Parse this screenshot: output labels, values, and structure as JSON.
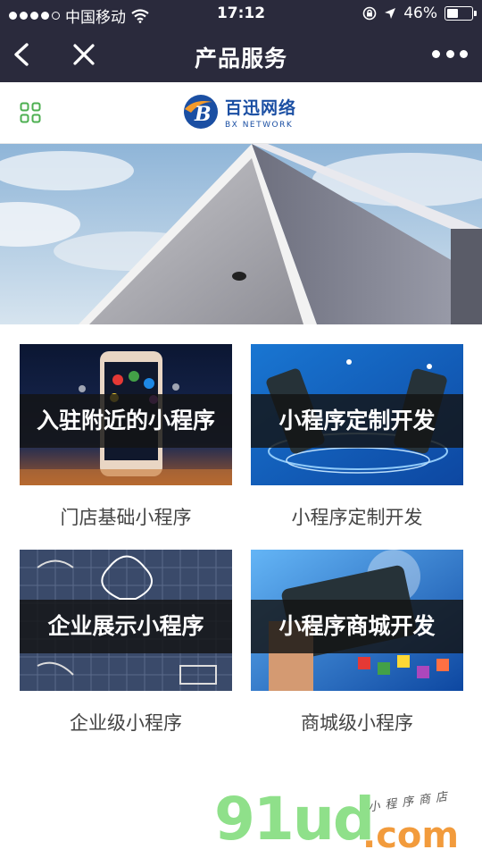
{
  "status_bar": {
    "carrier": "中国移动",
    "time": "17:12",
    "battery": "46%",
    "battery_level": 0.46,
    "signal_bars_filled": 4,
    "signal_bars_total": 5
  },
  "nav": {
    "title": "产品服务",
    "back_icon": "chevron-left-icon",
    "close_icon": "close-icon",
    "more_icon": "more-dots-icon"
  },
  "brand": {
    "name_cn": "百迅网络",
    "name_en": "BX NETWORK",
    "menu_icon": "grid-icon",
    "color": "#1b4fa3",
    "accent": "#f39a2b"
  },
  "products": [
    {
      "overlay": "入驻附近的小程序",
      "caption": "门店基础小程序"
    },
    {
      "overlay": "小程序定制开发",
      "caption": "小程序定制开发"
    },
    {
      "overlay": "企业展示小程序",
      "caption": "企业级小程序"
    },
    {
      "overlay": "小程序商城开发",
      "caption": "商城级小程序"
    }
  ],
  "watermark": {
    "brand": "91ud",
    "domain": ".com",
    "tagline": "小程序商店"
  },
  "colors": {
    "titlebar_bg": "#2a2a3c",
    "grid_icon": "#4caf50",
    "watermark_green": "#8fe08a",
    "watermark_orange": "#f29b3c"
  }
}
